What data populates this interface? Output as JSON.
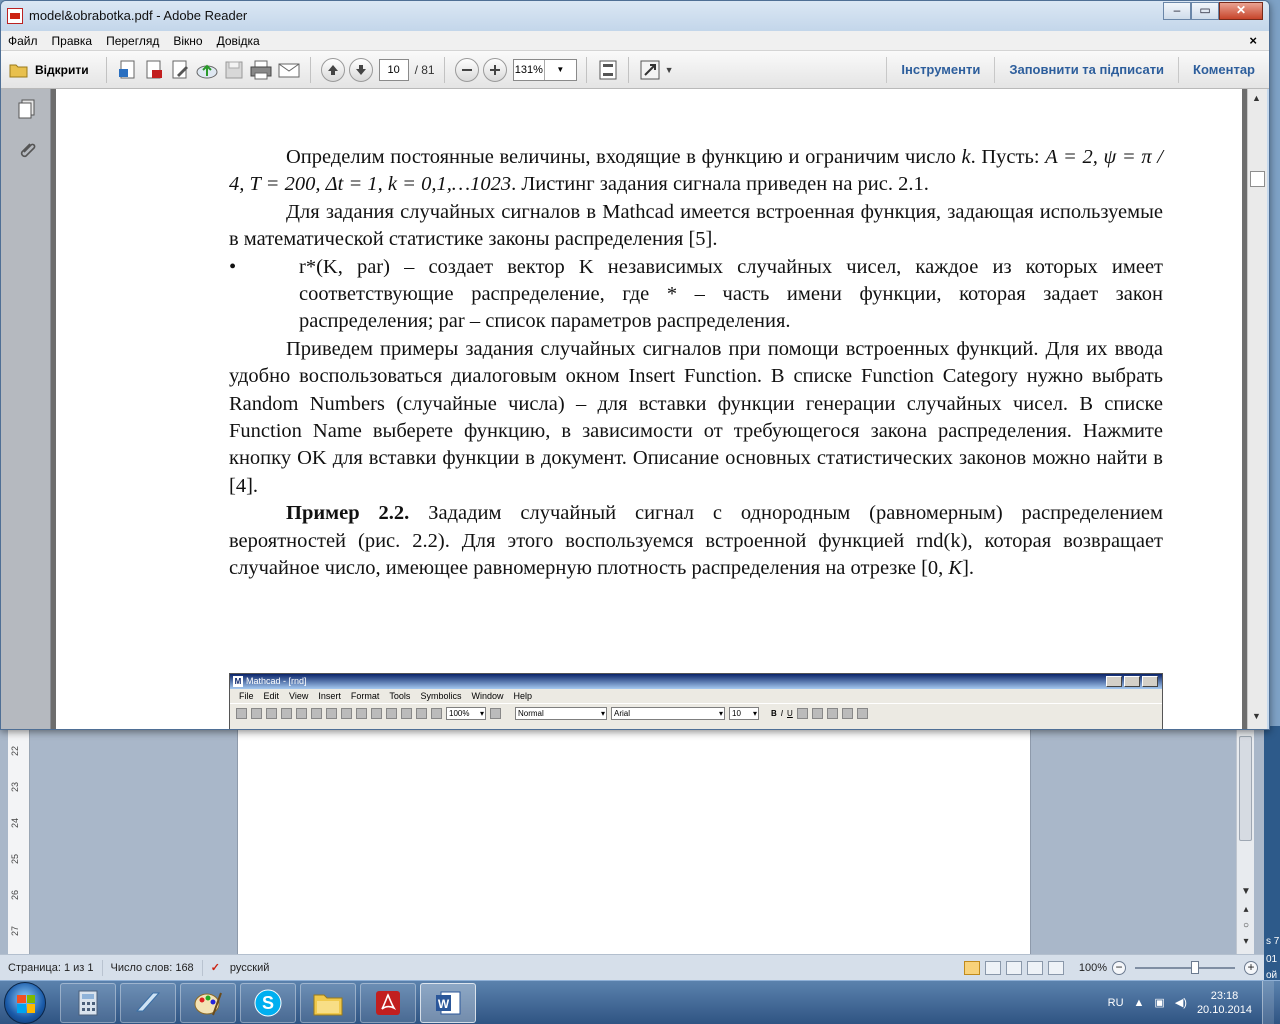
{
  "reader": {
    "title": "model&obrabotka.pdf - Adobe Reader",
    "window_buttons": {
      "minimize": "–",
      "maximize": "▭",
      "close": "✕"
    },
    "menu": [
      "Файл",
      "Правка",
      "Перегляд",
      "Вікно",
      "Довідка"
    ],
    "menu_close": "×",
    "toolbar": {
      "open_label": "Відкрити",
      "page_current": "10",
      "page_total": "/ 81",
      "zoom": "131%",
      "tabs": [
        "Інструменти",
        "Заповнити та підписати",
        "Коментар"
      ]
    },
    "document": {
      "p1": "Определим постоянные величины, входящие в функцию и ограничим число",
      "p1_k": " k",
      "p1_b": ". Пусть: ",
      "p1_formula": "A = 2, ψ = π / 4, T = 200, Δt = 1, k = 0,1,…1023",
      "p1_c": ". Листинг задания сигнала приведен на рис. 2.1.",
      "p2": "Для задания случайных сигналов в Mathcad имеется встроенная функция, задающая используемые в математической статистике законы распределения [5].",
      "bullet_symbol": "•",
      "bullet": "r*(K, par) – создает вектор K независимых случайных чисел, каждое из которых имеет соответствующие распределение, где * – часть имени функции, которая задает закон распределения; par – список параметров распределения.",
      "p3": "Приведем примеры задания случайных сигналов при помощи встроенных функций. Для их ввода удобно воспользоваться диалоговым окном Insert Function. В списке Function Category нужно выбрать Random Numbers (случайные числа) – для вставки функции генерации случайных чисел. В списке Function Name выберете функцию, в зависимости от требующегося закона распределения. Нажмите кнопку OK для вставки функции в документ. Описание основных статистических законов можно найти в [4].",
      "p4_bold": "Пример 2.2.",
      "p4": " Зададим случайный сигнал с однородным (равномерным) распределением вероятностей (рис. 2.2). Для этого воспользуемся встроенной функцией rnd(k), которая возвращает случайное число, имеющее равномерную плотность распределения на отрезке [0, ",
      "p4_k": "K",
      "p4_end": "]."
    },
    "mathcad": {
      "title": "Mathcad - [rnd]",
      "menu": [
        "File",
        "Edit",
        "View",
        "Insert",
        "Format",
        "Tools",
        "Symbolics",
        "Window",
        "Help"
      ],
      "zoom": "100%",
      "style": "Normal",
      "font": "Arial",
      "size": "10"
    }
  },
  "word": {
    "ruler_numbers": [
      "22",
      "23",
      "24",
      "25",
      "26",
      "27"
    ],
    "status": {
      "page": "Страница: 1 из 1",
      "words": "Число слов: 168",
      "lang": "русский",
      "zoom": "100%"
    }
  },
  "right_strip": [
    "s 7",
    "01",
    "ой"
  ],
  "taskbar": {
    "lang": "RU",
    "time": "23:18",
    "date": "20.10.2014"
  },
  "colors": {
    "accent": "#2d5e9c",
    "pdf_red": "#c21f1f"
  }
}
